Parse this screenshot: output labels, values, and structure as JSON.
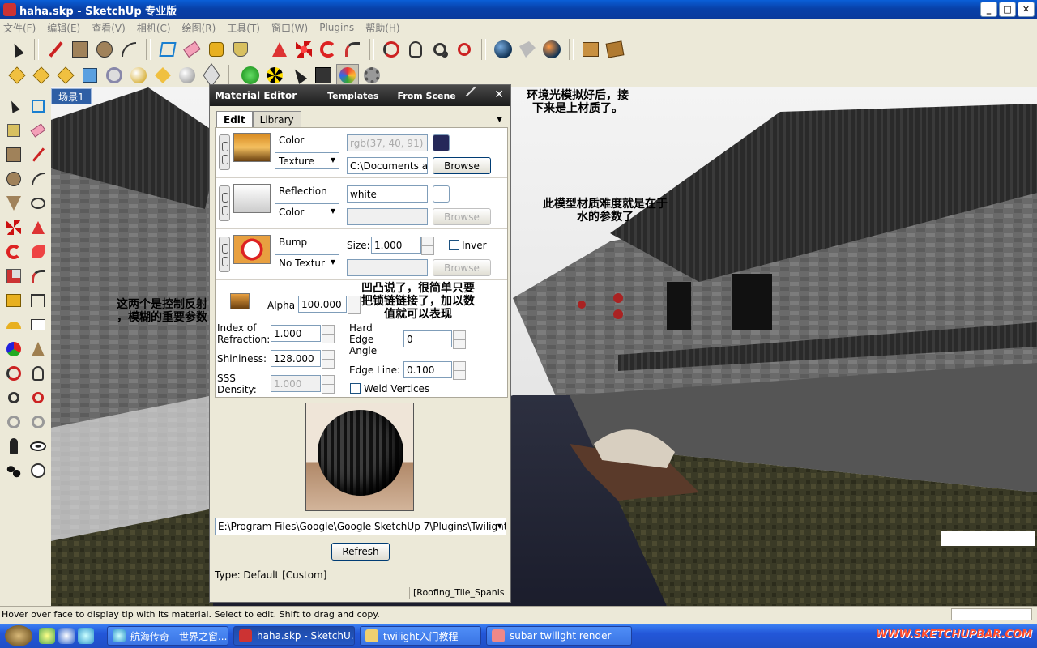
{
  "window": {
    "title": "haha.skp - SketchUp 专业版",
    "minimize": "_",
    "maximize": "□",
    "close": "✕"
  },
  "menu": [
    "文件(F)",
    "编辑(E)",
    "查看(V)",
    "相机(C)",
    "绘图(R)",
    "工具(T)",
    "窗口(W)",
    "Plugins",
    "帮助(H)"
  ],
  "scene": {
    "tab": "场景1"
  },
  "material_editor": {
    "title": "Material Editor",
    "links": [
      "Templates",
      "From Scene"
    ],
    "close": "✕",
    "tabs": [
      "Edit",
      "Library"
    ],
    "color": {
      "label": "Color",
      "type": "Texture",
      "value": "rgb(37, 40, 91)",
      "swatch": "#252859",
      "path": "C:\\Documents an",
      "browse": "Browse"
    },
    "reflection": {
      "label": "Reflection",
      "type": "Color",
      "value": "white",
      "browse": "Browse"
    },
    "bump": {
      "label": "Bump",
      "type": "No Textur",
      "size_label": "Size:",
      "size": "1.000",
      "invert_label": "Inver",
      "browse": "Browse"
    },
    "alpha_label": "Alpha",
    "alpha": "100.000",
    "ior_label_1": "Index of",
    "ior_label_2": "Refraction:",
    "ior": "1.000",
    "shininess_label": "Shininess:",
    "shininess": "128.000",
    "sss_label_1": "SSS",
    "sss_label_2": "Density:",
    "sss": "1.000",
    "hard_edge_1": "Hard",
    "hard_edge_2": "Edge",
    "hard_edge_3": "Angle",
    "hard_edge": "0",
    "edge_line_label": "Edge Line:",
    "edge_line": "0.100",
    "weld_label": "Weld Vertices",
    "plugin_path": "E:\\Program Files\\Google\\Google SketchUp 7\\Plugins\\Twilight\\",
    "refresh": "Refresh",
    "type_text": "Type: Default [Custom]",
    "material_name": "[Roofing_Tile_Spanis"
  },
  "annotations": {
    "env_1": "环境光模拟好后，接",
    "env_2": "下来是上材质了。",
    "water_1": "此模型材质难度就是在于",
    "water_2": "水的参数了",
    "bump_1": "凹凸说了，很简单只要",
    "bump_2": "把锁链链接了，加以数",
    "bump_3": "值就可以表现",
    "refl_1": "这两个是控制反射",
    "refl_2": "，模糊的重要参数"
  },
  "status": "Hover over face to display tip with its material. Select to edit. Shift to drag and copy.",
  "taskbar": {
    "items": [
      "航海传奇 - 世界之窗...",
      "haha.skp - SketchU...",
      "twilight入门教程",
      "subar twilight  render"
    ],
    "logo": "WWW.SKETCHUPBAR.COM"
  }
}
